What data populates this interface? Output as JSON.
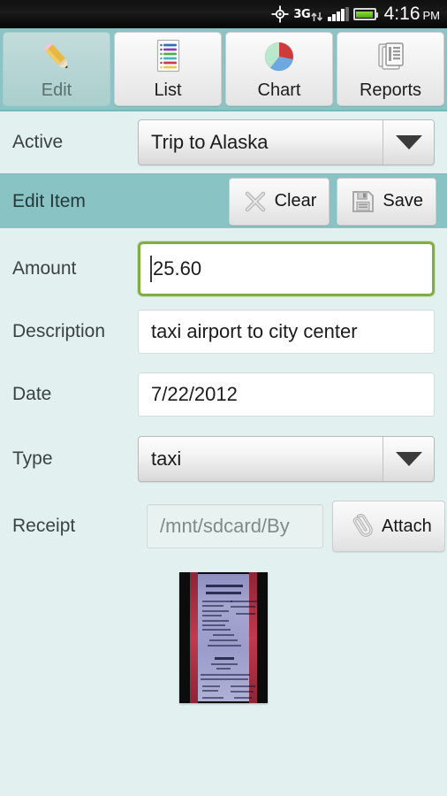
{
  "status_bar": {
    "gps_icon": "gps-crosshair-icon",
    "network_label": "3G",
    "network_arrows_icon": "data-transfer-arrows-icon",
    "signal_icon": "signal-bars-icon",
    "battery_icon": "battery-full-icon",
    "time": "4:16",
    "meridiem": "PM"
  },
  "tabs": [
    {
      "label": "Edit",
      "icon": "pencil-icon",
      "selected": true
    },
    {
      "label": "List",
      "icon": "list-icon",
      "selected": false
    },
    {
      "label": "Chart",
      "icon": "pie-chart-icon",
      "selected": false
    },
    {
      "label": "Reports",
      "icon": "documents-icon",
      "selected": false
    }
  ],
  "active_row": {
    "label": "Active",
    "value": "Trip to Alaska",
    "dropdown_icon": "chevron-down-icon"
  },
  "edit_item_bar": {
    "title": "Edit Item",
    "clear_label": "Clear",
    "clear_icon": "x-cross-icon",
    "save_label": "Save",
    "save_icon": "floppy-disk-icon"
  },
  "form": {
    "amount": {
      "label": "Amount",
      "value": "25.60",
      "focused": true
    },
    "description": {
      "label": "Description",
      "value": "taxi airport to city center"
    },
    "date": {
      "label": "Date",
      "value": "7/22/2012"
    },
    "type": {
      "label": "Type",
      "value": "taxi",
      "dropdown_icon": "chevron-down-icon"
    },
    "receipt": {
      "label": "Receipt",
      "value": "/mnt/sdcard/By",
      "attach_label": "Attach",
      "attach_icon": "paperclip-icon",
      "thumbnail_alt": "receipt-photo-thumbnail"
    }
  },
  "colors": {
    "background": "#e2f0ef",
    "tabbar": "#8cc3c5",
    "header_bar": "#89c3c4",
    "focus_green": "#81ae3f",
    "battery_green": "#6fc421"
  }
}
